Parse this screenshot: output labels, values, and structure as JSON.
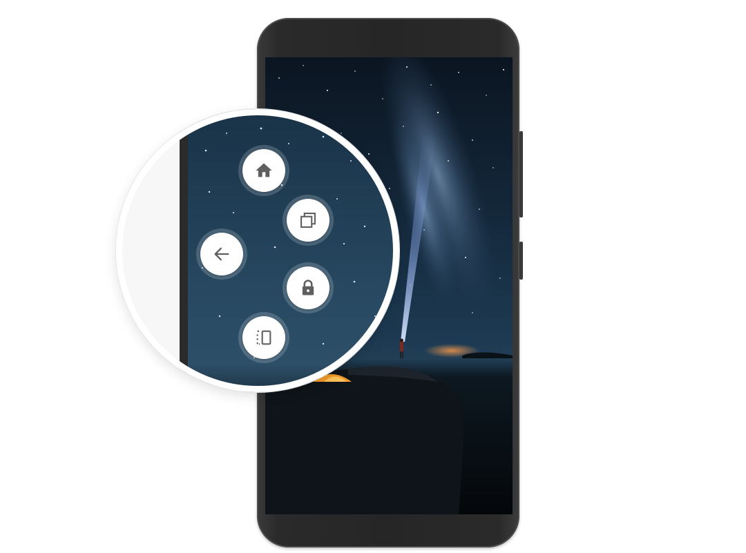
{
  "device": {
    "type": "android-phone",
    "frame_color": "#2a2a2a",
    "wallpaper": "night-sky-milky-way-flashlight"
  },
  "floating_menu": {
    "accent": "#ffffff",
    "icon_color": "#5f5f5f",
    "buttons": [
      {
        "id": "home",
        "icon": "home-icon"
      },
      {
        "id": "recents",
        "icon": "recent-apps-icon"
      },
      {
        "id": "back",
        "icon": "back-arrow-icon"
      },
      {
        "id": "lock",
        "icon": "lock-icon"
      },
      {
        "id": "rotate",
        "icon": "screen-rotate-icon"
      }
    ]
  }
}
